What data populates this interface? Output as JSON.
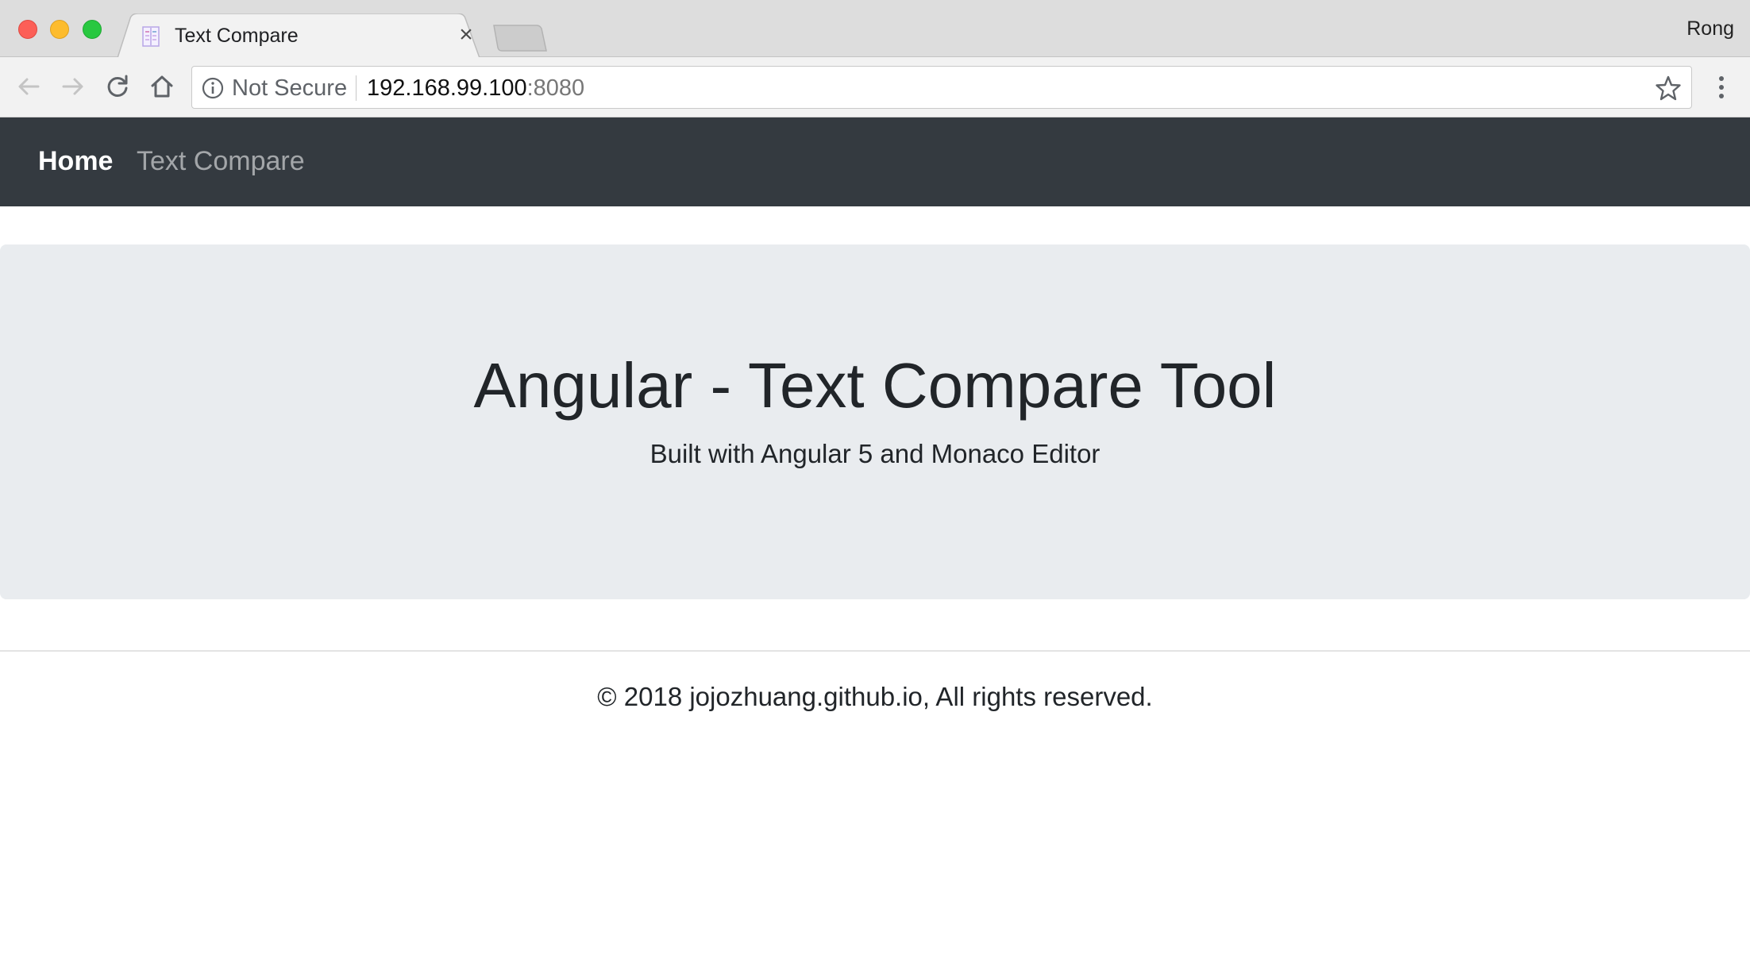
{
  "browser": {
    "tab": {
      "title": "Text Compare",
      "close_glyph": "×",
      "favicon": "document-icon"
    },
    "profile_name": "Rong",
    "toolbar": {
      "back_icon": "arrow-left-icon",
      "forward_icon": "arrow-right-icon",
      "reload_icon": "reload-icon",
      "home_icon": "home-icon",
      "menu_icon": "more-vertical-icon"
    },
    "omnibox": {
      "security_label": "Not Secure",
      "url_host": "192.168.99.100",
      "url_port": ":8080",
      "bookmark_icon": "star-icon"
    }
  },
  "navbar": {
    "brand": "Home",
    "links": [
      {
        "label": "Text Compare"
      }
    ]
  },
  "jumbotron": {
    "title": "Angular - Text Compare Tool",
    "subtitle": "Built with Angular 5 and Monaco Editor"
  },
  "footer": {
    "text": "© 2018 jojozhuang.github.io, All rights reserved."
  },
  "colors": {
    "navbar_bg": "#343a40",
    "jumbotron_bg": "#e9ecef",
    "text": "#212529"
  }
}
